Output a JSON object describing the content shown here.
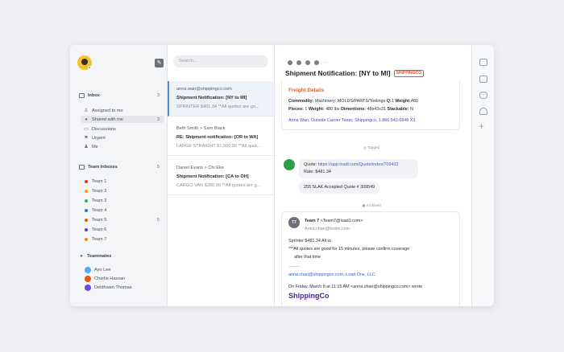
{
  "sidebar": {
    "inbox": {
      "label": "Inbox",
      "count": "3"
    },
    "items": [
      {
        "label": "Assigned to me",
        "icon": "person-icon"
      },
      {
        "label": "Shared with me",
        "icon": "people-icon",
        "count": "3"
      },
      {
        "label": "Discussions",
        "icon": "chat-icon"
      },
      {
        "label": "Urgent",
        "icon": "flag-icon"
      },
      {
        "label": "Me",
        "icon": "user-icon"
      }
    ],
    "team_inboxes": {
      "label": "Team Inboxes",
      "count": "5"
    },
    "teams": [
      {
        "label": "Team 1",
        "color": "#e03131"
      },
      {
        "label": "Team 2",
        "color": "#f59f00"
      },
      {
        "label": "Team 3",
        "color": "#37b24d"
      },
      {
        "label": "Team 4",
        "color": "#1c7ed6"
      },
      {
        "label": "Team 5",
        "color": "#e8590c",
        "count": "5"
      },
      {
        "label": "Team 6",
        "color": "#5f3dc4"
      },
      {
        "label": "Team 7",
        "color": "#f08c00"
      }
    ],
    "teammates": {
      "label": "Teammates"
    },
    "mates": [
      {
        "label": "Ayo Lee",
        "color": "#4dabf7"
      },
      {
        "label": "Charlie Hassan",
        "color": "#e8590c"
      },
      {
        "label": "Deldhawn Thomas",
        "color": "#7048e8"
      }
    ]
  },
  "search": {
    "placeholder": "Search..."
  },
  "conversations": [
    {
      "from": "anna.wan@shippingco.com",
      "subject": "Shipment Notification: [NY to MI]",
      "preview": "SPRINTER $481.34 **All quotes are go..."
    },
    {
      "from": "Beth Smith > Sam Black",
      "subject": "RE: Shipment notification: [OR to WA]",
      "preview": "LARGE STRAIGHT $1,500.90 **All quot..."
    },
    {
      "from": "Daniel Evans > Chi Eke",
      "subject": "Shipment Notification: [CA to OH]",
      "preview": "CARGO VAN $260.90 **All quotes are g..."
    }
  ],
  "message": {
    "subject": "Shipment Notification: [NY to MI]",
    "tag": "SHIPPINGCO",
    "freight": {
      "title": "Freight Details",
      "line1": {
        "commodity_label": "Commodity:",
        "commodity": "Machinery: MOLDS/PARTS/Toolings",
        "q_label": "Q:",
        "q": "1",
        "weight_label": "Weight:",
        "weight": "480"
      },
      "line2": {
        "pieces_label": "Pieces:",
        "pieces": "1",
        "weight_label": "Weight:",
        "weight": "480 lbs",
        "dims_label": "Dimentions:",
        "dims": "48x43x31",
        "stack_label": "Stackable:",
        "stack": "N"
      },
      "signature": "Anna Wan, Outside Carrier Team, Shippingco, 1.866.543.6848 X3"
    },
    "event1": "Tagged",
    "quote": {
      "label": "Quote:",
      "link": "https://app.loadl.com/Quote/index/709432",
      "rate": "Rate: $481.34"
    },
    "accepted": "255 SLAK Accepted Quote # 309549",
    "event2": "Archived",
    "reply": {
      "avatar": "T7",
      "sender": "Team 7",
      "sender_email": "<Team7@load1.com>",
      "to": "Anna.chan@fedex.com",
      "body1": "Sprinter $481.34 All in",
      "body2": "***All quotes are good for 15 minutes, please confirm coverage",
      "body3": "after that time",
      "sep": "--------",
      "sig": "anna.chan@shippingco.com, Load One, LLC",
      "on": "On Friday, March 8 at 11:15 AM <anna.chan@shippingco.com> wrote",
      "brand": "ShippingCo"
    }
  }
}
